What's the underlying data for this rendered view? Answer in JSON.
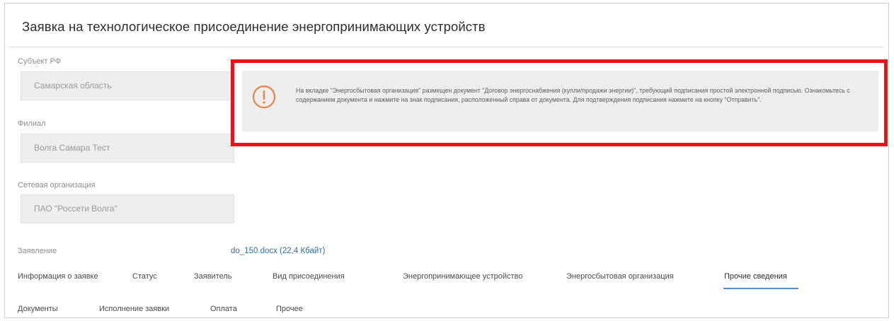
{
  "page": {
    "title": "Заявка на технологическое присоединение энергопринимающих устройств"
  },
  "fields": [
    {
      "label": "Субъект РФ",
      "value": "Самарская область"
    },
    {
      "label": "Филиал",
      "value": "Волга Самара Тест"
    },
    {
      "label": "Сетевая организация",
      "value": "ПАО \"Россети Волга\""
    }
  ],
  "alert": {
    "icon": "exclamation-circle-icon",
    "accent_color": "#e8844a",
    "text": "На вкладке \"Энергосбытовая организация\" размещен документ \"Договор энергоснабжения (купли/продажи энергии)\", требующий подписания простой электронной подписью. Ознакомьтесь с содержанием документа и нажмите на знак подписания, расположенный справа от документа. Для подтверждения подписания нажмите на кнопку \"Отправить\"."
  },
  "application": {
    "label": "Заявление",
    "file_link": "do_150.docx (22,4 Кбайт)"
  },
  "tabs_row1": [
    {
      "label": "Информация о заявке"
    },
    {
      "label": "Статус"
    },
    {
      "label": "Заявитель"
    },
    {
      "label": "Вид присоединения"
    },
    {
      "label": "Энергопринимающее устройство"
    },
    {
      "label": "Энергосбытовая организация"
    },
    {
      "label": "Прочие сведения",
      "active": true
    }
  ],
  "tabs_row2": [
    {
      "label": "Документы"
    },
    {
      "label": "Исполнение заявки"
    },
    {
      "label": "Оплата"
    },
    {
      "label": "Прочее"
    }
  ],
  "colors": {
    "highlight_border": "#e8141b",
    "link": "#2e6da4",
    "active_tab_underline": "#4a90d9"
  }
}
